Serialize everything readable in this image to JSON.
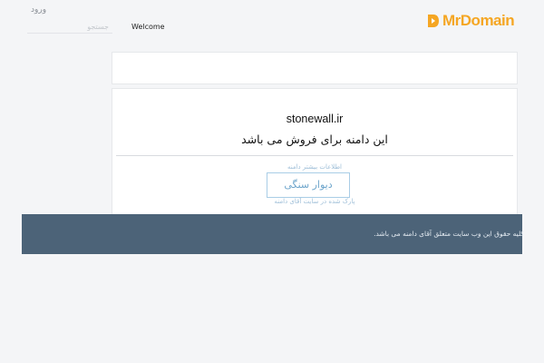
{
  "header": {
    "login_label": "ورود",
    "search_placeholder": "جستجو",
    "welcome_text": "Welcome",
    "logo_text": "MrDomain",
    "brand_color": "#f5a623"
  },
  "domain": {
    "name": "stonewall.ir",
    "for_sale_text": "این دامنه برای فروش می باشد",
    "more_info_label": "اطلاعات بیشتر دامنه",
    "buy_button_label": "دیوار سنگی",
    "parked_note": "پارک شده در سایت آقای دامنه"
  },
  "footer": {
    "copyright": "کلیه حقوق این وب سایت متعلق آقای دامنه می باشد.",
    "background_color": "#4c6378"
  }
}
